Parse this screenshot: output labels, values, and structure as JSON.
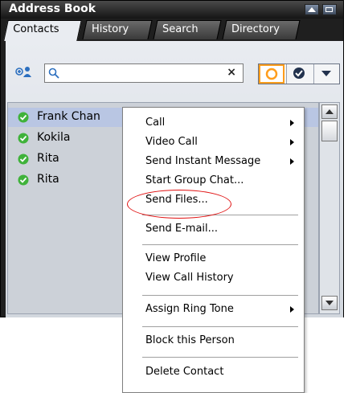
{
  "window": {
    "title": "Address Book"
  },
  "tabs": [
    "Contacts",
    "History",
    "Search",
    "Directory"
  ],
  "search": {
    "value": "",
    "placeholder": ""
  },
  "contacts": [
    {
      "name": "Frank Chan",
      "status": "available",
      "selected": true
    },
    {
      "name": "Kokila",
      "status": "available",
      "selected": false
    },
    {
      "name": "Rita",
      "status": "available",
      "selected": false
    },
    {
      "name": "Rita",
      "status": "available",
      "selected": false
    }
  ],
  "context_menu": {
    "items": [
      {
        "label": "Call",
        "submenu": true
      },
      {
        "label": "Video Call",
        "submenu": true
      },
      {
        "label": "Send Instant Message",
        "submenu": true
      },
      {
        "label": "Start Group Chat...",
        "submenu": false
      },
      {
        "label": "Send Files...",
        "submenu": false,
        "highlighted": true
      },
      {
        "label": "Send E-mail...",
        "submenu": false
      },
      {
        "label": "View Profile",
        "submenu": false
      },
      {
        "label": "View Call History",
        "submenu": false
      },
      {
        "label": "Assign Ring Tone",
        "submenu": true
      },
      {
        "label": "Block this Person",
        "submenu": false
      },
      {
        "label": "Delete Contact",
        "submenu": false
      }
    ]
  },
  "colors": {
    "status_available": "#3fb23a",
    "highlight_ring": "#e01010",
    "filter_active": "#ff9d1c"
  }
}
